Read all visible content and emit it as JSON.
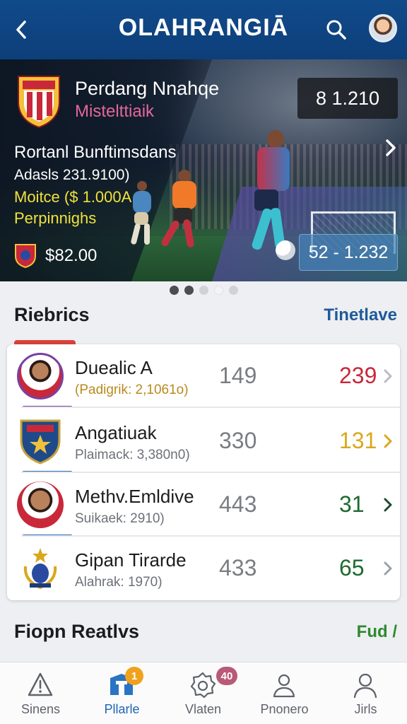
{
  "header": {
    "title": "OLAHRANGIĀ",
    "back_icon": "chevron-left-icon",
    "search_icon": "search-icon",
    "avatar_icon": "user-avatar"
  },
  "hero": {
    "title": "Perdang Nnahqe",
    "subtitle": "Mistelttiaik",
    "score_top": "8 1.210",
    "line1": "Rortanl Bunftimsdans",
    "line2": "Adasls 231.9100)",
    "line3": "Moitce ($ 1.000A",
    "line4": "Perpinnighs",
    "price": "$82.00",
    "score_bottom": "52 - 1.232",
    "colors": {
      "accent_pink": "#e4679c",
      "accent_yellow": "#f0e23c"
    }
  },
  "carousel": {
    "count": 5,
    "active_index": 1
  },
  "section": {
    "title": "Riebrics",
    "link": "Tinetlave"
  },
  "rows": [
    {
      "name": "Duealic A",
      "sub": "(Padigrik: 2,1061o)",
      "mid": "149",
      "value": "239",
      "value_color": "#c8283a",
      "chev_color": "#b9bcc1",
      "accent_color": "#7a3fa3",
      "sub_color": "#b98a1e",
      "avatar_icon": "player-avatar-icon"
    },
    {
      "name": "Angatiuak",
      "sub": "Plaimack: 3,380n0)",
      "mid": "330",
      "value": "131",
      "value_color": "#d9a81c",
      "chev_color": "#d9a81c",
      "accent_color": "#2a6fb3",
      "sub_color": "#6d7178",
      "avatar_icon": "club-crest-icon"
    },
    {
      "name": "Methv.Emldive",
      "sub": "Suikaek: 2910)",
      "mid": "443",
      "value": "31",
      "value_color": "#1f6a2f",
      "chev_color": "#1f4a2c",
      "accent_color": "#2a6fb3",
      "sub_color": "#6d7178",
      "avatar_icon": "player-avatar-icon"
    },
    {
      "name": "Gipan Tirarde",
      "sub": "Alahrak: 1970)",
      "mid": "433",
      "value": "65",
      "value_color": "#1f6a2f",
      "chev_color": "#9aa0a6",
      "accent_color": "#ffffff",
      "sub_color": "#6d7178",
      "avatar_icon": "trophy-crest-icon"
    }
  ],
  "section2": {
    "title": "Fiopn Reatlvs",
    "link": "Fud /"
  },
  "nav": [
    {
      "label": "Sinens",
      "icon": "alert-icon",
      "badge": ""
    },
    {
      "label": "Pllarle",
      "icon": "news-icon",
      "badge": "1",
      "active": true
    },
    {
      "label": "Vlaten",
      "icon": "settings-icon",
      "badge": "40"
    },
    {
      "label": "Pnonero",
      "icon": "profile-icon",
      "badge": ""
    },
    {
      "label": "Jirls",
      "icon": "user-icon",
      "badge": ""
    }
  ]
}
